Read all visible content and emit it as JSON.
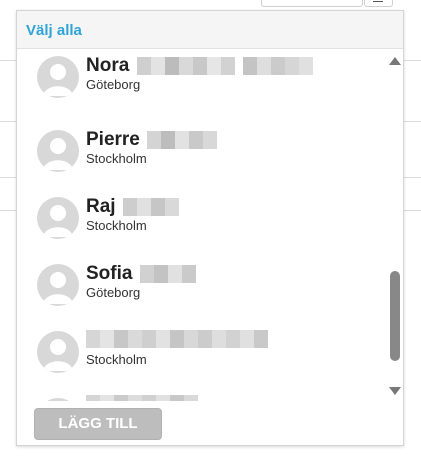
{
  "popup": {
    "select_all_label": "Välj alla",
    "add_button_label": "LÄGG TILL",
    "accent_color": "#2fa4d8"
  },
  "list": {
    "items": [
      {
        "first_name": "Nora",
        "surname_blurred": true,
        "city": "Göteborg"
      },
      {
        "first_name": "Pierre",
        "surname_blurred": true,
        "city": "Stockholm"
      },
      {
        "first_name": "Raj",
        "surname_blurred": true,
        "city": "Stockholm"
      },
      {
        "first_name": "Sofia",
        "surname_blurred": true,
        "city": "Göteborg"
      },
      {
        "first_name": "",
        "name_blurred": true,
        "city": "Stockholm"
      },
      {
        "first_name": "",
        "name_blurred": true,
        "city": ""
      }
    ]
  },
  "icons": {
    "avatar": "default-user-avatar-icon",
    "scroll_up": "triangle-up-icon",
    "scroll_down": "triangle-down-icon"
  }
}
